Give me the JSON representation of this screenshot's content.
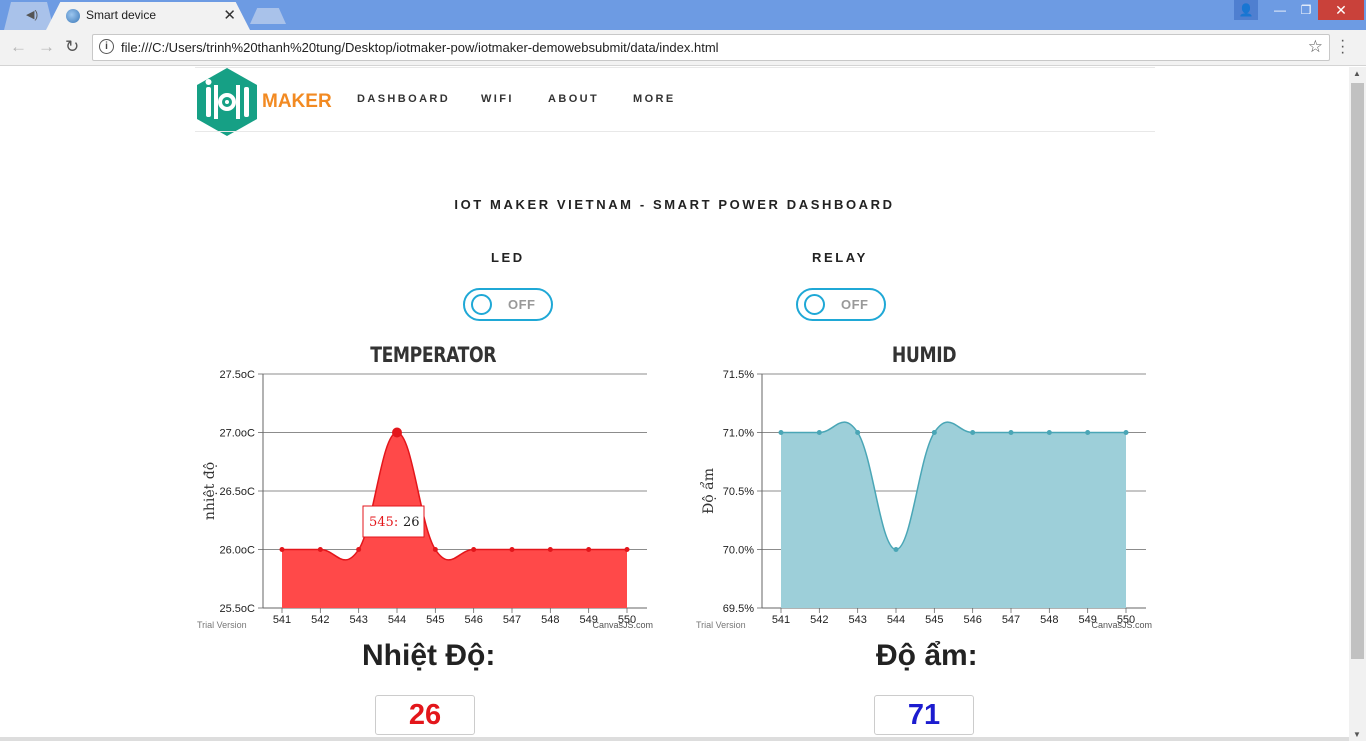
{
  "browser": {
    "tab_title": "Smart device",
    "url": "file:///C:/Users/trinh%20thanh%20tung/Desktop/iotmaker-pow/iotmaker-demowebsubmit/data/index.html"
  },
  "site": {
    "logo_text": "MAKER",
    "nav": [
      "DASHBOARD",
      "WIFI",
      "ABOUT",
      "MORE"
    ],
    "heading": "IOT MAKER VIETNAM - SMART POWER DASHBOARD"
  },
  "controls": {
    "led": {
      "label": "LED",
      "state": "OFF"
    },
    "relay": {
      "label": "RELAY",
      "state": "OFF"
    }
  },
  "readouts": {
    "temp_label": "Nhiệt Độ:",
    "temp_value": "26",
    "temp_color": "#e3161b",
    "humid_label": "Độ ẩm:",
    "humid_value": "71",
    "humid_color": "#1c1ccf"
  },
  "chart_data": [
    {
      "type": "area",
      "title": "TEMPERATOR",
      "ylabel": "nhiệt độ",
      "y_suffix": "oC",
      "x": [
        541,
        542,
        543,
        544,
        545,
        546,
        547,
        548,
        549,
        550
      ],
      "values": [
        26,
        26,
        26,
        27,
        26,
        26,
        26,
        26,
        26,
        26
      ],
      "ylim": [
        25.5,
        27.5
      ],
      "yticks": [
        "25.5oC",
        "26.0oC",
        "26.5oC",
        "27.0oC",
        "27.5oC"
      ],
      "color": "#ff4949",
      "line_color": "#e3161b",
      "tooltip": {
        "label": "545:",
        "value": "26"
      },
      "watermark_left": "Trial Version",
      "watermark_right": "CanvasJS.com"
    },
    {
      "type": "area",
      "title": "HUMID",
      "ylabel": "Độ ẩm",
      "y_suffix": "%",
      "x": [
        541,
        542,
        543,
        544,
        545,
        546,
        547,
        548,
        549,
        550
      ],
      "values": [
        71,
        71,
        71,
        70,
        71,
        71,
        71,
        71,
        71,
        71
      ],
      "ylim": [
        69.5,
        71.5
      ],
      "yticks": [
        "69.5%",
        "70.0%",
        "70.5%",
        "71.0%",
        "71.5%"
      ],
      "color": "#9dcfd9",
      "line_color": "#4aa6b6",
      "watermark_left": "Trial Version",
      "watermark_right": "CanvasJS.com"
    }
  ]
}
